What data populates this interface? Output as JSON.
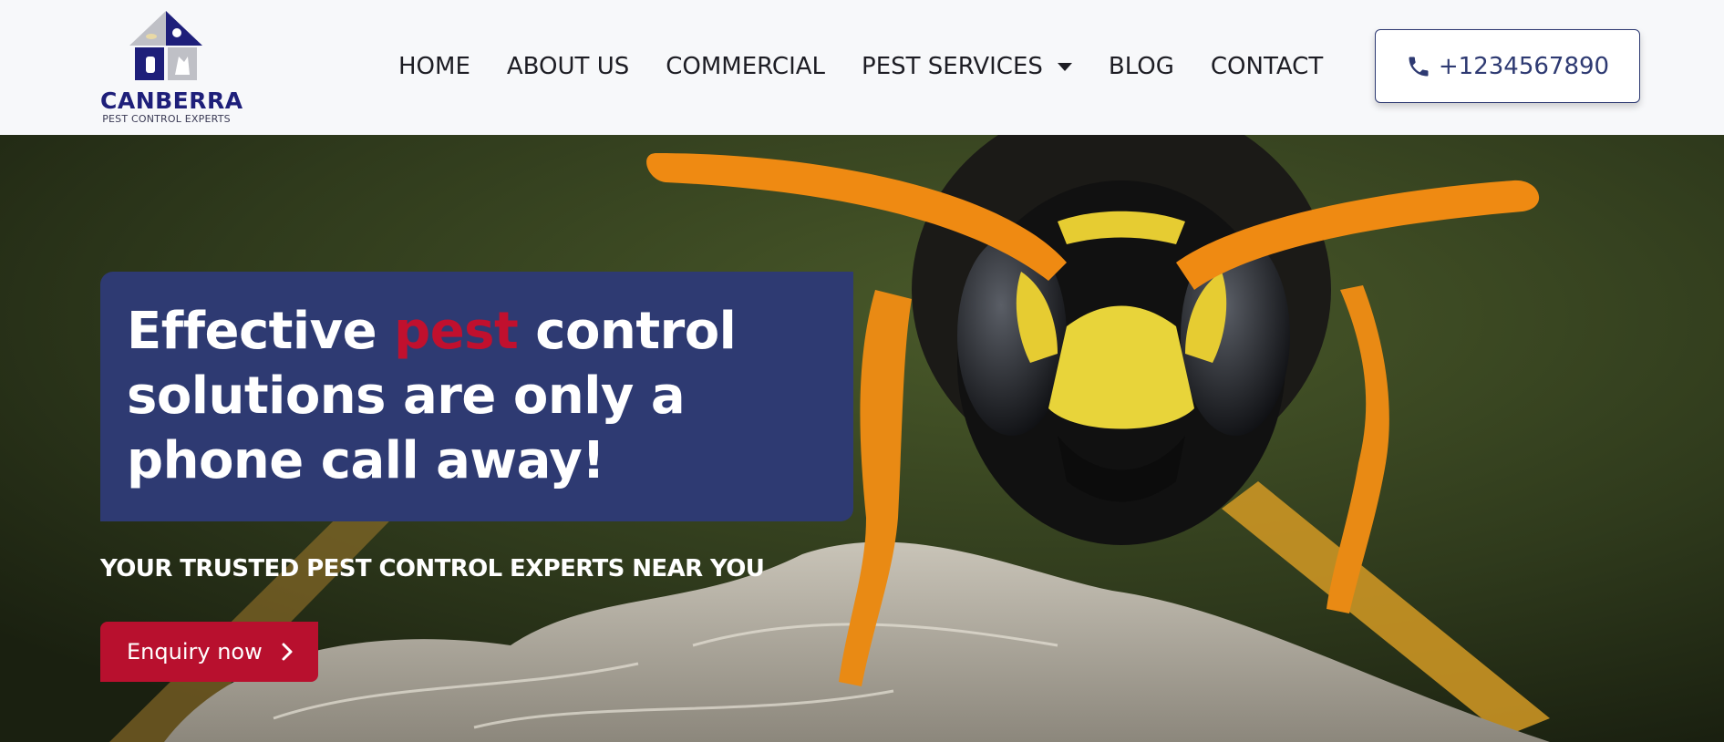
{
  "brand": {
    "name": "CANBERRA",
    "tagline": "PEST CONTROL EXPERTS",
    "logo_icon": "house-logo-icon",
    "colors": {
      "navy": "#1e1f7a",
      "slate": "#2e3a72",
      "red": "#b8102e"
    }
  },
  "nav": {
    "items": [
      {
        "label": "HOME"
      },
      {
        "label": "ABOUT US"
      },
      {
        "label": "COMMERCIAL"
      },
      {
        "label": "PEST SERVICES",
        "has_dropdown": true
      },
      {
        "label": "BLOG"
      },
      {
        "label": "CONTACT"
      }
    ]
  },
  "phone": {
    "icon": "phone-icon",
    "number": "+1234567890"
  },
  "hero": {
    "headline_part1": "Effective ",
    "headline_accent": "pest",
    "headline_part2": " control solutions are only a phone call away!",
    "subheading": "YOUR TRUSTED PEST CONTROL EXPERTS NEAR YOU",
    "cta_label": "Enquiry now",
    "cta_icon": "chevron-right-icon",
    "image_subject": "wasp-close-up"
  }
}
